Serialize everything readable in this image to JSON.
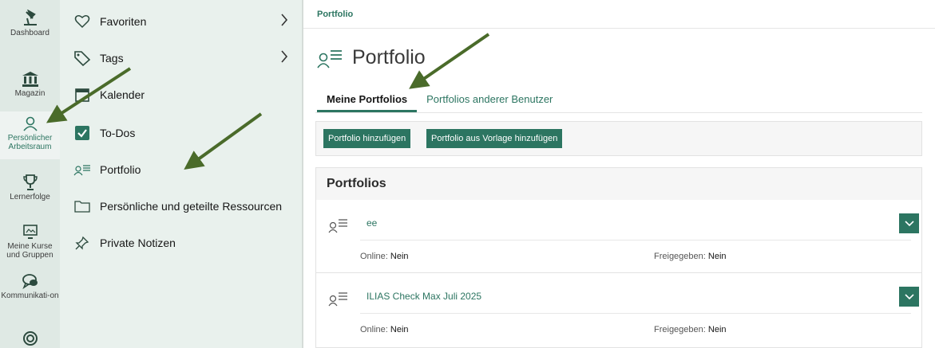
{
  "mainbar": {
    "items": [
      {
        "label": "Dashboard"
      },
      {
        "label": "Magazin"
      },
      {
        "label": "Persönlicher Arbeitsraum"
      },
      {
        "label": "Lernerfolge"
      },
      {
        "label": "Meine Kurse und Gruppen"
      },
      {
        "label": "Kommunikati-on"
      }
    ]
  },
  "slate": {
    "items": [
      {
        "label": "Favoriten",
        "icon": "heart-icon"
      },
      {
        "label": "Tags",
        "icon": "tag-icon"
      },
      {
        "label": "Kalender",
        "icon": "calendar-icon"
      },
      {
        "label": "To-Dos",
        "icon": "checkbox-icon"
      },
      {
        "label": "Portfolio",
        "icon": "portfolio-icon"
      },
      {
        "label": "Persönliche und geteilte Ressourcen",
        "icon": "folder-icon"
      },
      {
        "label": "Private Notizen",
        "icon": "pin-icon"
      }
    ]
  },
  "content": {
    "breadcrumb": "Portfolio",
    "title": "Portfolio",
    "tabs": [
      {
        "label": "Meine Portfolios",
        "active": true
      },
      {
        "label": "Portfolios anderer Benutzer",
        "active": false
      }
    ],
    "toolbar": {
      "add_label": "Portfolio hinzufügen",
      "add_template_label": "Portfolio aus Vorlage hinzufügen"
    },
    "panel": {
      "heading": "Portfolios",
      "rows": [
        {
          "title": "ee",
          "online_label": "Online:",
          "online_value": "Nein",
          "shared_label": "Freigegeben:",
          "shared_value": "Nein"
        },
        {
          "title": "ILIAS Check Max Juli 2025",
          "online_label": "Online:",
          "online_value": "Nein",
          "shared_label": "Freigegeben:",
          "shared_value": "Nein"
        }
      ]
    }
  },
  "colors": {
    "accent": "#2c7561",
    "mainbar_bg": "#dfe9e4",
    "slate_bg": "#e9f1ed",
    "arrow": "#4a6b2a"
  }
}
